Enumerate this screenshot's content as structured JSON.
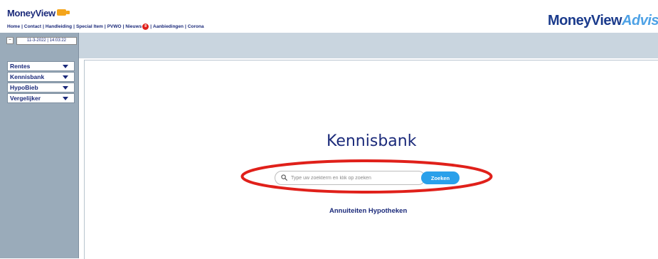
{
  "header": {
    "logo_text": "MoneyView",
    "brand_part1": "MoneyView",
    "brand_part2": "Advisc",
    "nav": [
      "Home",
      "Contact",
      "Handleiding",
      "Special Item",
      "PVWO",
      "Nieuws",
      "Aanbiedingen",
      "Corona"
    ],
    "news_badge": "8"
  },
  "sidebar": {
    "datetime": "11-3-2022 | 14:03:22",
    "collapse_symbol": "−",
    "menu": [
      {
        "label": "Rentes"
      },
      {
        "label": "Kennisbank"
      },
      {
        "label": "HypoBieb"
      },
      {
        "label": "Vergelijker"
      }
    ]
  },
  "main": {
    "title": "Kennisbank",
    "search_placeholder": "Type uw zoekterm en klik op zoeken",
    "search_button": "Zoeken",
    "link": "Annuiteiten Hypotheken"
  },
  "colors": {
    "navy": "#1b2a7a",
    "accent_blue": "#2aa0ea",
    "highlight_red": "#e0201a",
    "sidebar": "#9aabba",
    "logo_orange": "#f4a51c"
  },
  "icons": [
    "search-icon",
    "chevron-down-icon",
    "logo-badge-icon"
  ]
}
